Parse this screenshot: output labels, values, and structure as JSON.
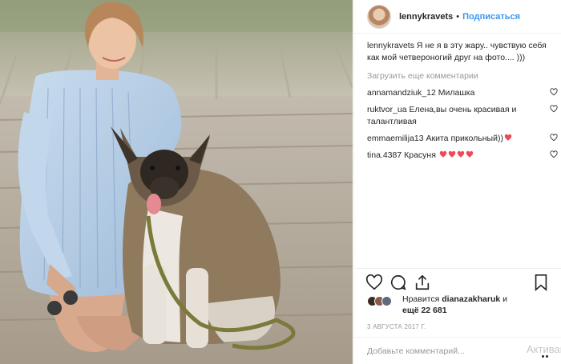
{
  "post": {
    "username": "lennykravets",
    "separator": "•",
    "follow_label": "Подписаться",
    "caption_username": "lennykravets",
    "caption_text": "Я не я в эту жару.. чувствую себя как мой четвероногий друг на фото.... )))",
    "load_more_label": "Загрузить еще комментарии",
    "comments": [
      {
        "username": "annamandziuk_12",
        "text": "Милашка",
        "hearts": 0
      },
      {
        "username": "ruktvor_ua",
        "text": "Елена,вы очень красивая и талантливая",
        "hearts": 0
      },
      {
        "username": "emmaemilija13",
        "text": "Акита прикольный))",
        "hearts": 1
      },
      {
        "username": "tina.4387",
        "text": "Красуня",
        "hearts": 4
      }
    ],
    "likes_prefix": "Нравится",
    "likes_user": "dianazakharuk",
    "likes_and": "и",
    "likes_more": "ещё 22 681",
    "date": "3 АВГУСТА 2017 Г.",
    "comment_placeholder": "Добавьте комментарий...",
    "watermark_text": "Активация"
  },
  "colors": {
    "link_blue": "#3897f0",
    "heart_red": "#ed4956",
    "text": "#262626",
    "muted": "#999999"
  },
  "icons": [
    "heart-icon",
    "comment-icon",
    "share-icon",
    "bookmark-icon",
    "options-icon"
  ]
}
